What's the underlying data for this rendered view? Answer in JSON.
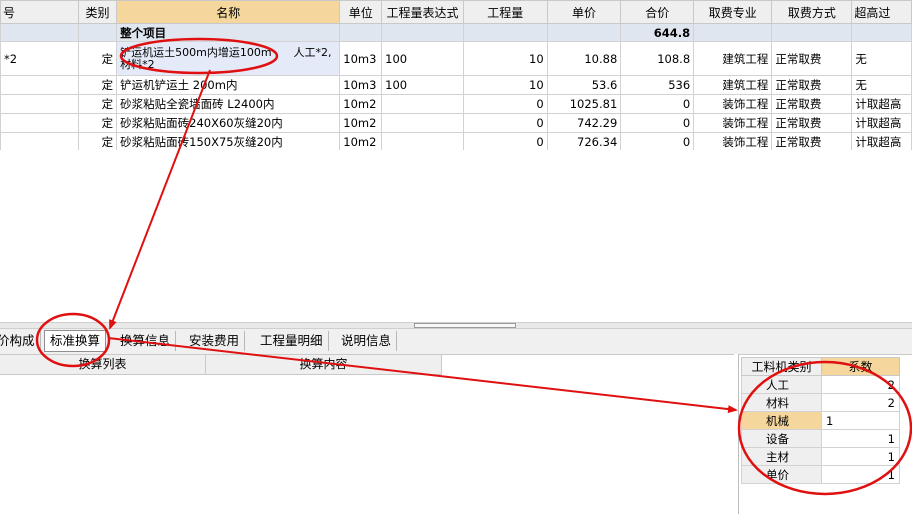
{
  "columns": {
    "code": "号",
    "type": "类别",
    "name": "名称",
    "unit": "单位",
    "expr": "工程量表达式",
    "qty": "工程量",
    "price": "单价",
    "total": "合价",
    "fee_major": "取费专业",
    "fee_method": "取费方式",
    "over_height": "超高过"
  },
  "summary_row": {
    "name": "整个项目",
    "total": "644.8"
  },
  "rows": [
    {
      "code": "*2",
      "type": "定",
      "name": "铲运机运土500m内增运100m　　人工*2,材料*2",
      "unit": "10m3",
      "expr": "100",
      "qty": "10",
      "price": "10.88",
      "total": "108.8",
      "fee_major": "建筑工程",
      "fee_method": "正常取费",
      "over_height": "无"
    },
    {
      "code": "",
      "type": "定",
      "name": "铲运机铲运土 200m内",
      "unit": "10m3",
      "expr": "100",
      "qty": "10",
      "price": "53.6",
      "total": "536",
      "fee_major": "建筑工程",
      "fee_method": "正常取费",
      "over_height": "无"
    },
    {
      "code": "",
      "type": "定",
      "name": "砂浆粘贴全瓷墙面砖 L2400内",
      "unit": "10m2",
      "expr": "",
      "qty": "0",
      "price": "1025.81",
      "total": "0",
      "fee_major": "装饰工程",
      "fee_method": "正常取费",
      "over_height": "计取超高"
    },
    {
      "code": "",
      "type": "定",
      "name": "砂浆粘贴面砖240X60灰缝20内",
      "unit": "10m2",
      "expr": "",
      "qty": "0",
      "price": "742.29",
      "total": "0",
      "fee_major": "装饰工程",
      "fee_method": "正常取费",
      "over_height": "计取超高"
    },
    {
      "code": "",
      "type": "定",
      "name": "砂浆粘贴面砖150X75灰缝20内",
      "unit": "10m2",
      "expr": "",
      "qty": "0",
      "price": "726.34",
      "total": "0",
      "fee_major": "装饰工程",
      "fee_method": "正常取费",
      "over_height": "计取超高"
    }
  ],
  "tabs": [
    "价构成",
    "标准换算",
    "换算信息",
    "安装费用",
    "工程量明细",
    "说明信息"
  ],
  "active_tab": "标准换算",
  "lower_left": {
    "col1": "换算列表",
    "col2": "换算内容"
  },
  "coef_panel": {
    "header_category": "工料机类别",
    "header_coef": "系数",
    "rows": [
      {
        "category": "人工",
        "coef": "2"
      },
      {
        "category": "材料",
        "coef": "2"
      },
      {
        "category": "机械",
        "coef": "1"
      },
      {
        "category": "设备",
        "coef": "1"
      },
      {
        "category": "主材",
        "coef": "1"
      },
      {
        "category": "单价",
        "coef": "1"
      }
    ],
    "selected_category": "机械"
  },
  "colors": {
    "header_highlight": "#f5d79e",
    "annotation_red": "#e01010",
    "selected_row": "#e4eaf8"
  }
}
